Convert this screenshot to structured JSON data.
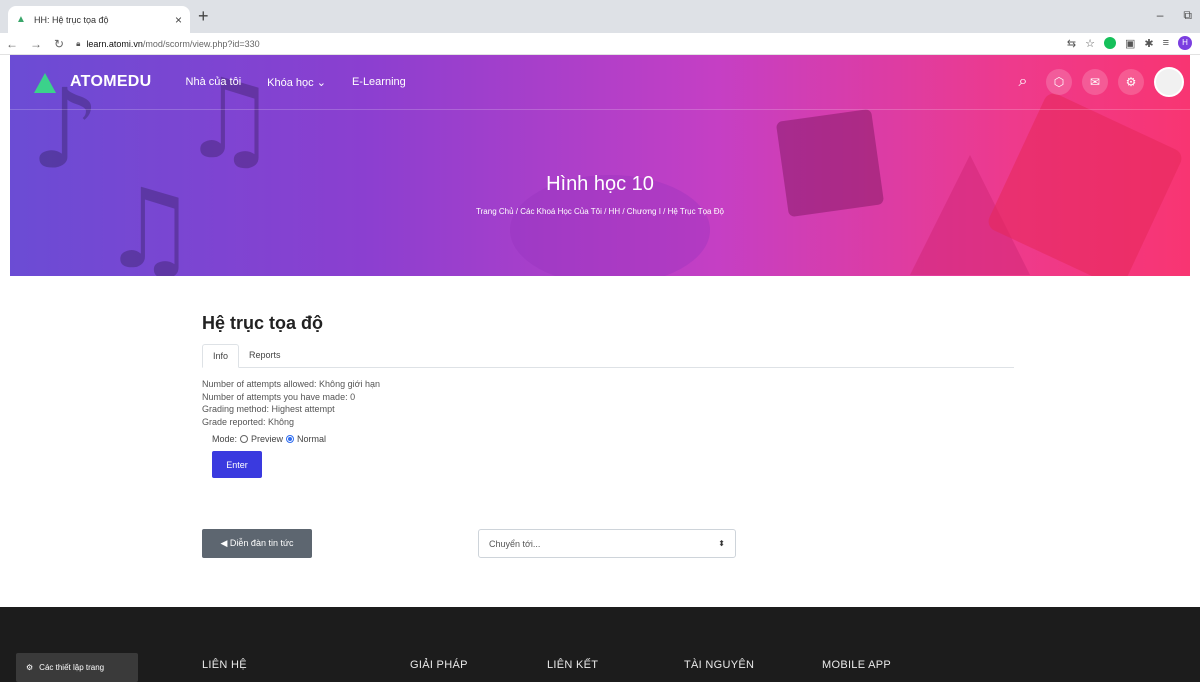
{
  "browser": {
    "tab_title": "HH: Hệ trục tọa độ",
    "tab_close": "×",
    "new_tab": "+",
    "url_host": "learn.atomi.vn",
    "url_path": "/mod/scorm/view.php?id=330",
    "win_minimize": "–",
    "win_restore": "⧉",
    "profile_letter": "H"
  },
  "nav": {
    "brand": "ATOMEDU",
    "links": [
      "Nhà của tôi",
      "Khóa học ⌄",
      "E-Learning"
    ]
  },
  "hero": {
    "title": "Hình học 10",
    "breadcrumb": "Trang Chủ / Các Khoá Học Của Tôi / HH / Chương I / Hệ Trục Tọa Độ"
  },
  "main": {
    "title": "Hệ trục tọa độ",
    "tabs": [
      "Info",
      "Reports"
    ],
    "info_lines": [
      "Number of attempts allowed: Không giới hạn",
      "Number of attempts you have made: 0",
      "Grading method: Highest attempt",
      "Grade reported: Không"
    ],
    "mode_label": "Mode:",
    "mode_preview": "Preview",
    "mode_normal": "Normal",
    "enter_label": "Enter"
  },
  "bottom_nav": {
    "prev_label": "◀ Diễn đàn tin tức",
    "jump_placeholder": "Chuyển tới..."
  },
  "footer": {
    "settings_label": "Các thiết lập trang",
    "columns": [
      "LIÊN HỆ",
      "GIẢI PHÁP",
      "LIÊN KẾT",
      "TÀI NGUYÊN",
      "MOBILE APP"
    ]
  },
  "colors": {
    "hero_start": "#6b4cd4",
    "hero_end": "#f83572",
    "enter_button": "#3a3adf",
    "footer_bg": "#1c1c1c"
  }
}
